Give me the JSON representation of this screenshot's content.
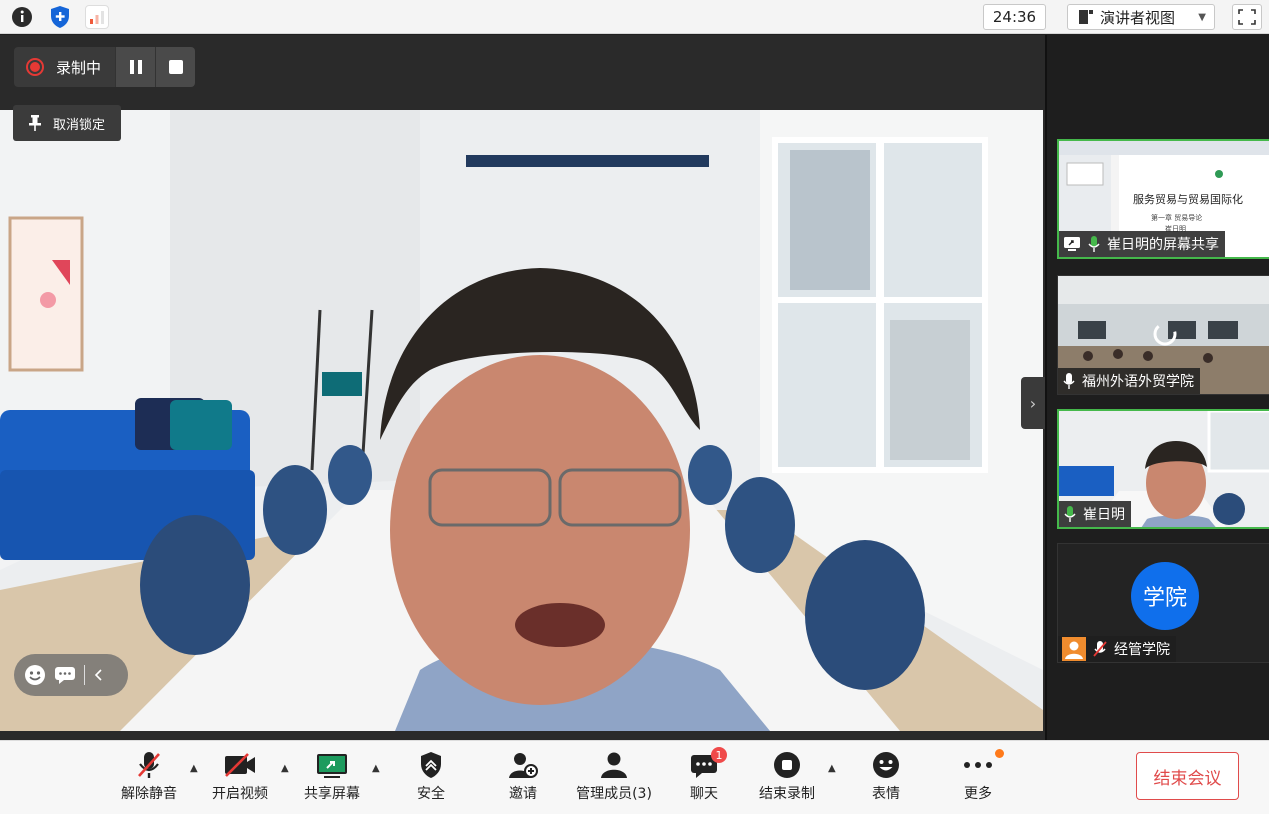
{
  "topbar": {
    "timer": "24:36",
    "view_mode": "演讲者视图"
  },
  "recording": {
    "status": "录制中",
    "unlock_label": "取消锁定"
  },
  "participants": [
    {
      "label": "崔日明的屏幕共享"
    },
    {
      "label": "福州外语外贸学院"
    },
    {
      "label": "崔日明"
    },
    {
      "label": "经管学院",
      "avatar_text": "学院"
    }
  ],
  "shared_slide": {
    "title": "服务贸易与贸易国际化",
    "subtitle": "第一章 贸易导论",
    "author": "崔日明"
  },
  "toolbar": {
    "mute": "解除静音",
    "video": "开启视频",
    "share": "共享屏幕",
    "security": "安全",
    "invite": "邀请",
    "members": "管理成员(3)",
    "chat": "聊天",
    "chat_badge": "1",
    "stop_record": "结束录制",
    "reactions": "表情",
    "more": "更多",
    "end_meeting": "结束会议"
  },
  "colors": {
    "accent_green": "#45b84b",
    "record_red": "#e53935",
    "end_red": "#e04b4b",
    "avatar_blue": "#0f6fec"
  }
}
